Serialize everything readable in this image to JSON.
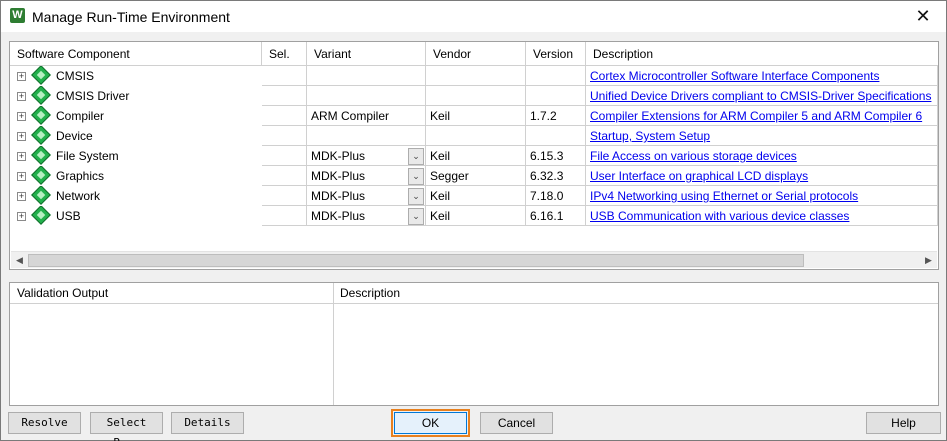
{
  "window": {
    "title": "Manage Run-Time Environment",
    "icon_glyph": "W",
    "close_glyph": "✕"
  },
  "grid": {
    "headers": {
      "component": "Software Component",
      "sel": "Sel.",
      "variant": "Variant",
      "vendor": "Vendor",
      "version": "Version",
      "description": "Description"
    },
    "rows": [
      {
        "name": "CMSIS",
        "variant": "",
        "vendor": "",
        "version": "",
        "description": "Cortex Microcontroller Software Interface Components",
        "dropdown": false
      },
      {
        "name": "CMSIS Driver",
        "variant": "",
        "vendor": "",
        "version": "",
        "description": "Unified Device Drivers compliant to CMSIS-Driver Specifications",
        "dropdown": false
      },
      {
        "name": "Compiler",
        "variant": "ARM Compiler",
        "vendor": "Keil",
        "version": "1.7.2",
        "description": "Compiler Extensions for ARM Compiler 5 and ARM Compiler 6",
        "dropdown": false
      },
      {
        "name": "Device",
        "variant": "",
        "vendor": "",
        "version": "",
        "description": "Startup, System Setup",
        "dropdown": false
      },
      {
        "name": "File System",
        "variant": "MDK-Plus",
        "vendor": "Keil",
        "version": "6.15.3",
        "description": "File Access on various storage devices",
        "dropdown": true
      },
      {
        "name": "Graphics",
        "variant": "MDK-Plus",
        "vendor": "Segger",
        "version": "6.32.3",
        "description": "User Interface on graphical LCD displays",
        "dropdown": true
      },
      {
        "name": "Network",
        "variant": "MDK-Plus",
        "vendor": "Keil",
        "version": "7.18.0",
        "description": "IPv4 Networking using Ethernet or Serial protocols",
        "dropdown": true
      },
      {
        "name": "USB",
        "variant": "MDK-Plus",
        "vendor": "Keil",
        "version": "6.16.1",
        "description": "USB Communication with various device classes",
        "dropdown": true
      }
    ],
    "expander_glyph": "+",
    "dropdown_glyph": "⌄",
    "scroll_left_glyph": "◀",
    "scroll_right_glyph": "▶"
  },
  "validation": {
    "output_header": "Validation Output",
    "description_header": "Description"
  },
  "buttons": {
    "resolve": "Resolve",
    "select_packs": "Select P...",
    "details": "Details",
    "ok": "OK",
    "cancel": "Cancel",
    "help": "Help"
  },
  "colors": {
    "link": "#0000ee",
    "focus_outline": "#e8801e",
    "component_icon": "#22b14c"
  }
}
